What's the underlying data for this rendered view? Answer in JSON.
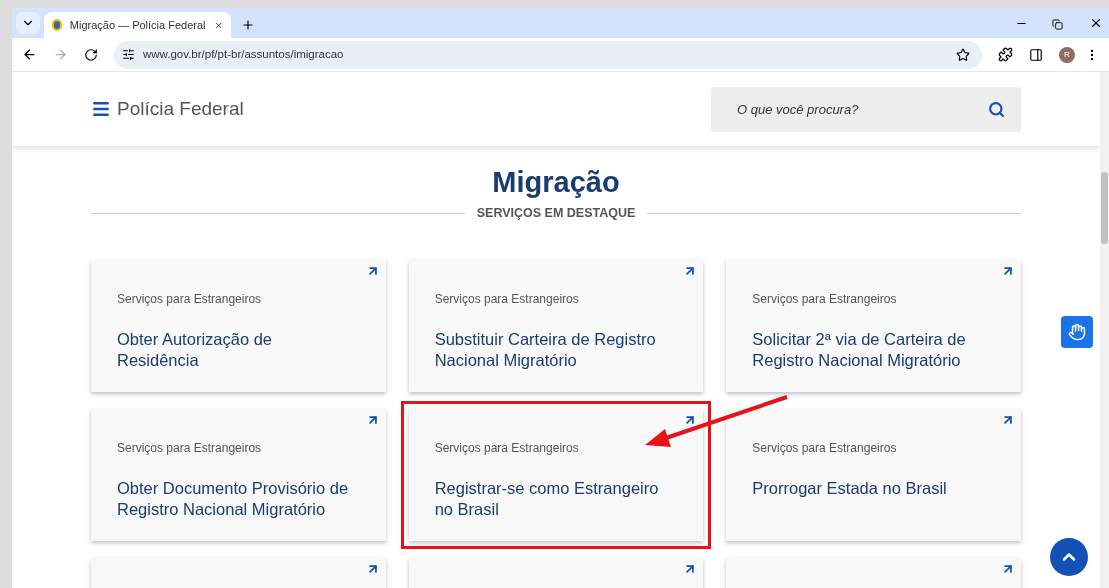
{
  "browser": {
    "tab_title": "Migração — Polícia Federal",
    "url": "www.gov.br/pf/pt-br/assuntos/imigracao",
    "profile_initial": "R"
  },
  "header": {
    "site_name": "Polícia Federal",
    "search": {
      "placeholder": "O que você procura?"
    }
  },
  "page": {
    "title": "Migração",
    "section_label": "SERVIÇOS EM DESTAQUE"
  },
  "cards": [
    {
      "kind": "full",
      "category": "Serviços para Estrangeiros",
      "title": "Obter Autorização de Residência",
      "highlighted": false
    },
    {
      "kind": "full",
      "category": "Serviços para Estrangeiros",
      "title": "Substituir Carteira de Registro Nacional Migratório",
      "highlighted": false
    },
    {
      "kind": "full",
      "category": "Serviços para Estrangeiros",
      "title": "Solicitar 2ª via de Carteira de Registro Nacional Migratório",
      "highlighted": false
    },
    {
      "kind": "full",
      "category": "Serviços para Estrangeiros",
      "title": "Obter Documento Provisório de Registro Nacional Migratório",
      "highlighted": false
    },
    {
      "kind": "full",
      "category": "Serviços para Estrangeiros",
      "title": "Registrar-se como Estrangeiro no Brasil",
      "highlighted": true
    },
    {
      "kind": "full",
      "category": "Serviços para Estrangeiros",
      "title": "Prorrogar Estada no Brasil",
      "highlighted": false
    },
    {
      "kind": "cut"
    },
    {
      "kind": "cut"
    },
    {
      "kind": "cut"
    }
  ]
}
